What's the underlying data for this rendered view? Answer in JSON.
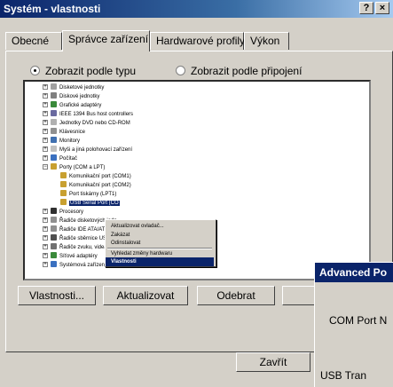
{
  "window": {
    "title": "Systém - vlastnosti",
    "help": "?",
    "close": "×"
  },
  "tabs": [
    "Obecné",
    "Správce zařízení",
    "Hardwarové profily",
    "Výkon"
  ],
  "view": {
    "by_type": "Zobrazit podle typu",
    "by_connection": "Zobrazit podle připojení"
  },
  "tree": [
    "Disketové jednotky",
    "Diskové jednotky",
    "Grafické adaptéry",
    "IEEE 1394 Bus host controllers",
    "Jednotky DVD nebo CD-ROM",
    "Klávesnice",
    "Monitory",
    "Myši a jiná polohovací zařízení",
    "Počítač",
    "Porty (COM a LPT)",
    "Komunikační port (COM1)",
    "Komunikační port (COM2)",
    "Port tiskárny (LPT1)",
    "USB Serial Port (CO",
    "Procesory",
    "Řadiče disketových jedn",
    "Řadiče IDE ATA/ATAPI",
    "Řadiče sběrnice USB",
    "Řadiče zvuku, videa a h",
    "Síťové adaptéry",
    "Systémová zařízení"
  ],
  "context_menu": [
    "Aktualizovat ovladač...",
    "Zakázat",
    "Odinstalovat",
    "Vyhledat změny hardwaru",
    "Vlastnosti"
  ],
  "buttons": {
    "properties": "Vlastnosti...",
    "update": "Aktualizovat",
    "remove": "Odebrat",
    "close": "Zavřít"
  },
  "advanced": {
    "title": "Advanced Po",
    "com_label": "COM Port N",
    "usb_label": "USB Tran"
  }
}
